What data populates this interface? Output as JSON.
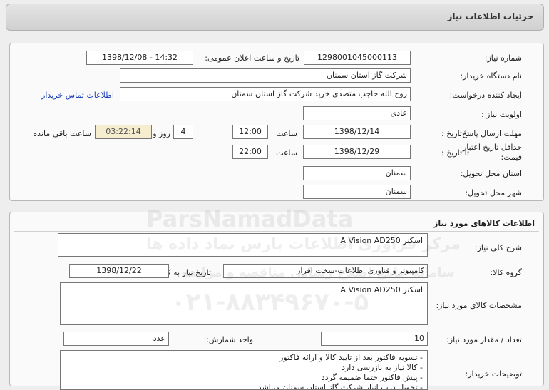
{
  "header": {
    "title": "جزئیات اطلاعات نیاز"
  },
  "need_info": {
    "need_number_label": "شماره نیاز:",
    "need_number": "1298001045000113",
    "announce_label": "تاریخ و ساعت اعلان عمومی:",
    "announce_value": "1398/12/08 - 14:32",
    "buyer_org_label": "نام دستگاه خریدار:",
    "buyer_org": "شرکت گاز استان سمنان",
    "creator_label": "ایجاد کننده درخواست:",
    "creator": "روح الله  حاجب متصدی خرید شرکت گاز استان سمنان",
    "contact_link": "اطلاعات تماس خریدار",
    "priority_label": "اولویت نیاز :",
    "priority": "عادی",
    "reply_deadline_label": "مهلت ارسال پاسخ:",
    "to_date_label": "تا تاریخ :",
    "reply_date": "1398/12/14",
    "time_label": "ساعت",
    "reply_time": "12:00",
    "days_value": "4",
    "days_label": "روز و",
    "remaining_time": "03:22:14",
    "remaining_label": "ساعت باقی مانده",
    "validity_label": "حداقل تاریخ اعتبار قیمت:",
    "validity_date": "1398/12/29",
    "validity_time": "22:00",
    "province_label": "استان محل تحویل:",
    "province": "سمنان",
    "city_label": "شهر محل تحویل:",
    "city": "سمنان"
  },
  "goods": {
    "section_title": "اطلاعات کالاهای مورد نیاز",
    "summary_label": "شرح کلي نياز:",
    "summary": "اسکنر A Vision AD250",
    "group_label": "گروه کالا:",
    "group": "کامپیوتر و فناوری اطلاعات-سخت افزار",
    "need_date_label": "تاریخ نیاز به کالا:",
    "need_date": "1398/12/22",
    "specs_label": "مشخصات کالاي مورد نياز:",
    "specs": "اسکنر A Vision AD250",
    "qty_label": "تعداد / مقدار مورد نیاز:",
    "qty": "10",
    "unit_label": "واحد شمارش:",
    "unit": "عدد",
    "notes_label": "توضیحات خریدار:",
    "notes": [
      "- تسویه فاکتور بعد از تایید کالا و ارائه فاکتور",
      "- کالا نیاز به بازرسی دارد",
      "- پیش فاکتور حتما ضمیمه گردد",
      "- تحویل درب انبار شرکت گاز استان سمنان میباشد"
    ]
  },
  "watermark": {
    "brand": "ParsNamadData",
    "subtitle": "مرکز فرآوری اطلاعات پارس نماد داده ها",
    "tagline": "سامانه جامع اطلاع رسانی مناقصه و مزایده",
    "phone": "۰۲۱-۸۸۳۴۹۶۷۰-۵"
  }
}
